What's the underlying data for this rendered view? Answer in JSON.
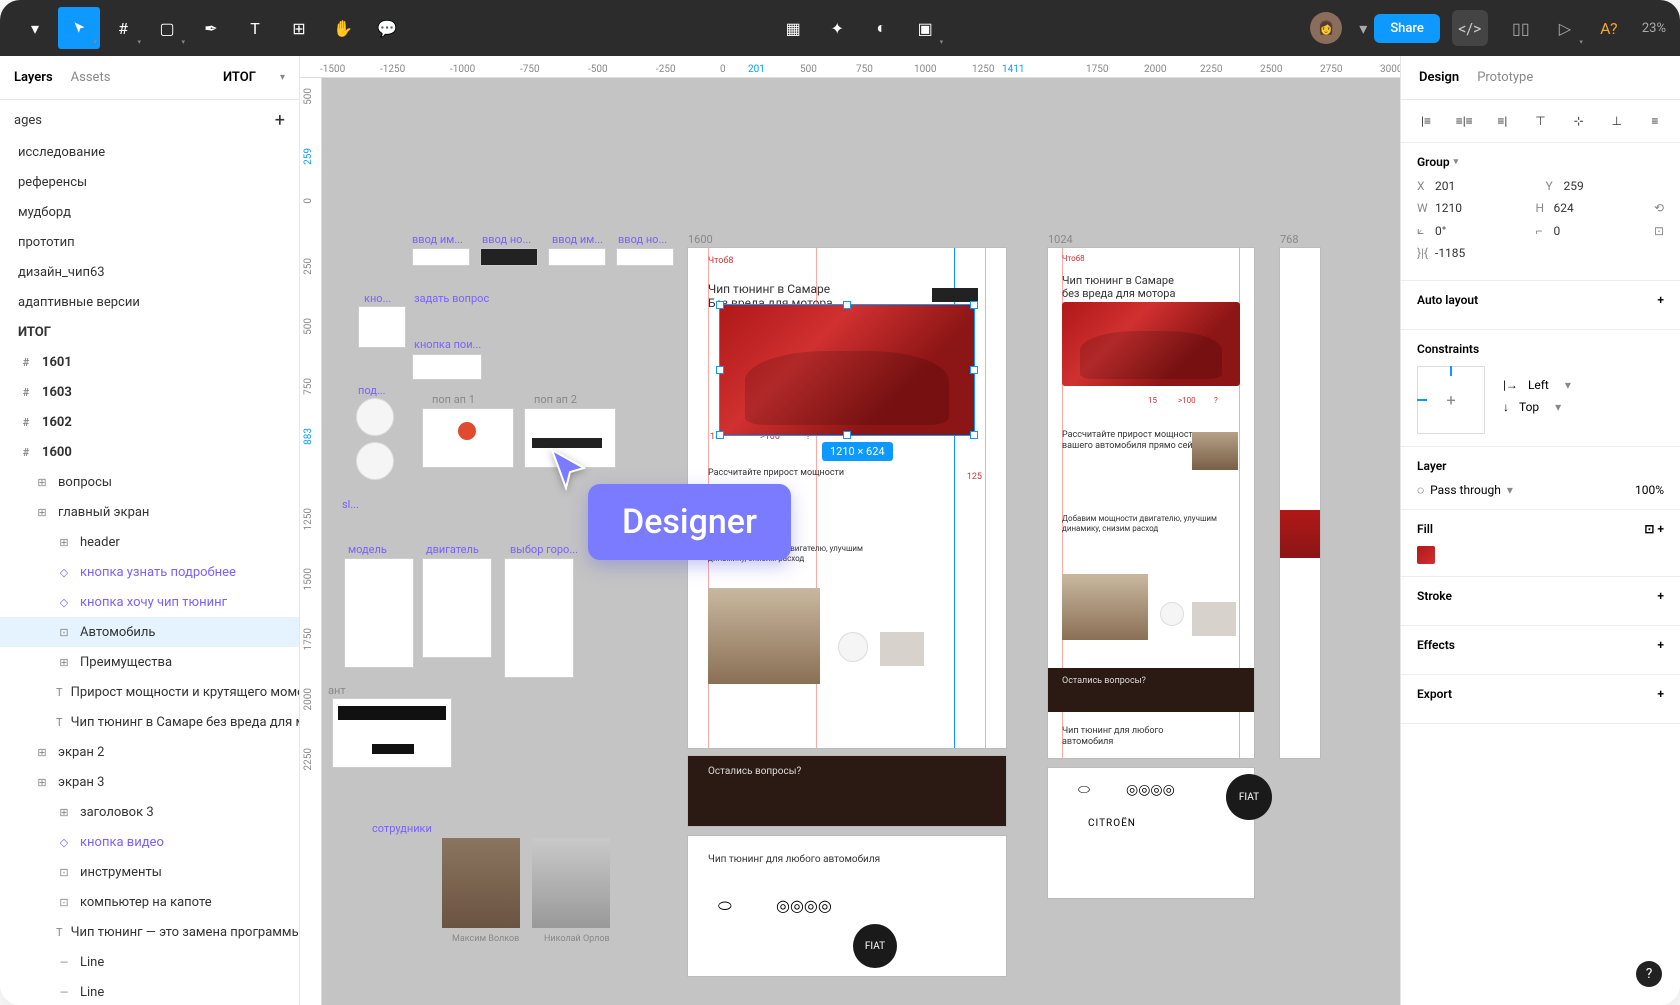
{
  "toolbar": {
    "share_label": "Share",
    "zoom": "23%",
    "missing_font": "A?"
  },
  "left": {
    "tab_layers": "Layers",
    "tab_assets": "Assets",
    "doc_title": "ИТОГ",
    "pages_label": "ages",
    "pages": [
      {
        "label": "исследование"
      },
      {
        "label": "референсы"
      },
      {
        "label": "мудборд"
      },
      {
        "label": "прототип"
      },
      {
        "label": "дизайн_чип63"
      },
      {
        "label": "адаптивные версии"
      },
      {
        "label": "ИТОГ",
        "bold": true
      }
    ],
    "layers": [
      {
        "label": "1601",
        "icon": "#",
        "bold": true
      },
      {
        "label": "1603",
        "icon": "#",
        "bold": true
      },
      {
        "label": "1602",
        "icon": "#",
        "bold": true
      },
      {
        "label": "1600",
        "icon": "#",
        "bold": true
      },
      {
        "label": "вопросы",
        "icon": "⊞",
        "indent": 1
      },
      {
        "label": "главный экран",
        "icon": "⊞",
        "indent": 1
      },
      {
        "label": "header",
        "icon": "⊞",
        "indent": 2
      },
      {
        "label": "кнопка узнать подробнее",
        "icon": "◇",
        "indent": 2,
        "purple": true
      },
      {
        "label": "кнопка хочу чип тюнинг",
        "icon": "◇",
        "indent": 2,
        "purple": true
      },
      {
        "label": "Автомобиль",
        "icon": "⊡",
        "indent": 2,
        "active": true
      },
      {
        "label": "Преимущества",
        "icon": "⊞",
        "indent": 2
      },
      {
        "label": "Прирост мощности и крутящего момента  для атмо...",
        "icon": "T",
        "indent": 2
      },
      {
        "label": "Чип тюнинг в Самаре без вреда для мотора",
        "icon": "T",
        "indent": 2
      },
      {
        "label": "экран 2",
        "icon": "⊞",
        "indent": 1
      },
      {
        "label": "экран 3",
        "icon": "⊞",
        "indent": 1
      },
      {
        "label": "заголовок 3",
        "icon": "⊞",
        "indent": 2
      },
      {
        "label": "кнопка видео",
        "icon": "◇",
        "indent": 2,
        "purple": true
      },
      {
        "label": "инструменты",
        "icon": "⊡",
        "indent": 2
      },
      {
        "label": "компьютер на капоте",
        "icon": "⊡",
        "indent": 2
      },
      {
        "label": "Чип тюнинг — это замена программы в блоке упра...",
        "icon": "T",
        "indent": 2
      },
      {
        "label": "Line",
        "icon": "—",
        "indent": 2
      },
      {
        "label": "Line",
        "icon": "—",
        "indent": 2
      }
    ]
  },
  "canvas": {
    "ruler_top": [
      "-1500",
      "-1250",
      "-1000",
      "-750",
      "-500",
      "-250",
      "0",
      "201",
      "500",
      "750",
      "1000",
      "1250",
      "1411",
      "1750",
      "2000",
      "2250",
      "2500",
      "2750",
      "3000"
    ],
    "ruler_left": [
      "500",
      "259",
      "0",
      "250",
      "500",
      "750",
      "883",
      "1250",
      "1500",
      "1750",
      "2000",
      "2250"
    ],
    "sel_badge": "1210 × 624",
    "frame_1600": "1600",
    "frame_1024": "1024",
    "frame_768": "768",
    "hero_title_1600": "Чип тюнинг в Самаре",
    "hero_sub_1600": "Без вреда для мотора",
    "hero_title_1024_a": "Чип тюнинг в Самаре",
    "hero_title_1024_b": "без вреда для мотора",
    "calc_1600": "Рассчитайте прирост мощности",
    "calc_1024_a": "Рассчитайте прирост мощности",
    "calc_1024_b": "вашего автомобиля прямо сейчас",
    "add_1024_a": "Добавим мощности двигателю, улучшим",
    "add_1024_b": "динамику, снизим расход",
    "add_1600_a": "Добавим мощности двигателю, улучшим",
    "add_1600_b": "динамику, снизим расход",
    "questions": "Остались вопросы?",
    "anycar_1600": "Чип тюнинг для любого автомобиля",
    "anycar_1024_a": "Чип тюнинг для любого",
    "anycar_1024_b": "автомобиля",
    "components": {
      "vvod_im": "ввод им...",
      "vvod_no1": "ввод но...",
      "vvod_im2": "ввод им...",
      "vvod_no2": "ввод но...",
      "kno": "кно...",
      "zadat": "задать вопрос",
      "knopka_poi": "кнопка пои...",
      "pod": "под...",
      "pop1": "поп ап 1",
      "pop2": "поп ап 2",
      "sl": "sl...",
      "model": "модель",
      "dvigatel": "двигатель",
      "vybor": "выбор горо...",
      "sotrudniki": "сотрудники",
      "ant": "ант"
    },
    "dims": {
      "d15": "15",
      "d100": ">100",
      "dq": "?",
      "d125": "125"
    },
    "names": {
      "n1": "Максим Волков",
      "n2": "Николай Орлов"
    }
  },
  "right": {
    "tab_design": "Design",
    "tab_prototype": "Prototype",
    "group_label": "Group",
    "props": {
      "X": "201",
      "Y": "259",
      "W": "1210",
      "H": "624",
      "angle": "0°",
      "radius": "0",
      "other": "-1185"
    },
    "auto_layout": "Auto layout",
    "constraints_label": "Constraints",
    "constraints": {
      "h": "Left",
      "v": "Top"
    },
    "layer_label": "Layer",
    "blend": "Pass through",
    "opacity": "100%",
    "fill_label": "Fill",
    "stroke_label": "Stroke",
    "effects_label": "Effects",
    "export_label": "Export"
  },
  "overlay": {
    "designer": "Designer"
  }
}
